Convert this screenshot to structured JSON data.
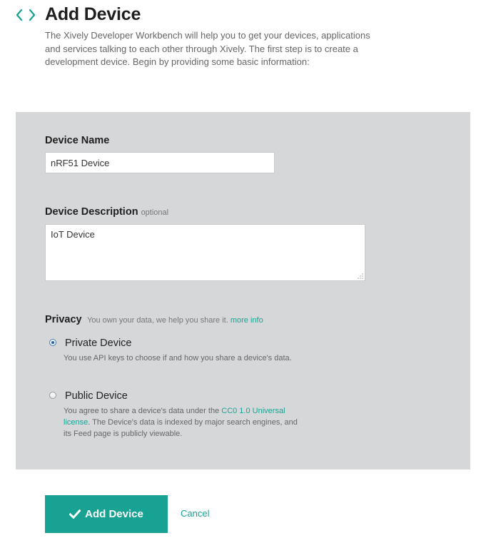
{
  "header": {
    "title": "Add Device",
    "intro": "The Xively Developer Workbench will help you to get your devices, applications and services talking to each other through Xively. The first step is to create a development device. Begin by providing some basic information:",
    "icon": "code-brackets-icon"
  },
  "form": {
    "device_name": {
      "label": "Device Name",
      "value": "nRF51 Device"
    },
    "device_description": {
      "label": "Device Description",
      "optional_hint": "optional",
      "value": "IoT Device"
    },
    "privacy": {
      "label": "Privacy",
      "hint": "You own your data, we help you share it.",
      "more_info_link": "more info",
      "options": [
        {
          "title": "Private Device",
          "selected": true,
          "description": "You use API keys to choose if and how you share a device's data."
        },
        {
          "title": "Public Device",
          "selected": false,
          "description_before": "You agree to share a device's data under the",
          "license_link": "CC0 1.0 Universal license",
          "description_after": ". The Device's data is indexed by major search engines, and its Feed page is publicly viewable."
        }
      ]
    }
  },
  "actions": {
    "submit_label": "Add Device",
    "cancel_label": "Cancel"
  },
  "colors": {
    "accent": "#17a293",
    "panel_background": "#d6d7d9",
    "heading": "#1f1f1f",
    "muted_text": "#666666"
  }
}
